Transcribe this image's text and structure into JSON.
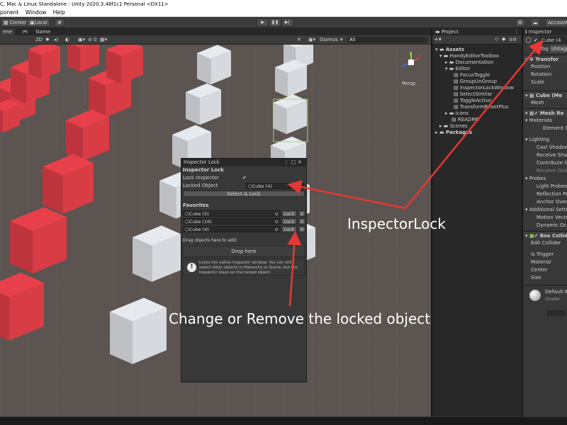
{
  "window": {
    "title": "C, Mac & Linux Standalone - Unity 2020.3.48f1c1 Personal <DX11>"
  },
  "menu": [
    "ponent",
    "Window",
    "Help"
  ],
  "toolbar": {
    "center": "Center",
    "local": "Local",
    "account": "Account"
  },
  "scene_tabs": {
    "scene": "ene",
    "game": "Game"
  },
  "scene_tools": {
    "mode": "2D",
    "gizmos": "Gizmos",
    "search_placeholder": "All",
    "zero": "0"
  },
  "gizmo_label": "Persp",
  "project": {
    "tab": "Project",
    "items": [
      "Assets",
      "HandyEditorToolbox",
      "Documentation",
      "Editor",
      "FocusToggle",
      "GroupUnGroup",
      "InspectorLockWindow",
      "SelectSimilar",
      "ToggleActive",
      "TransformResetPlus",
      "Icons",
      "README",
      "Scenes",
      "Packages"
    ],
    "badge": "9"
  },
  "inspector": {
    "tab": "Inspector",
    "object_name": "Cube (4",
    "tag_label": "Tag",
    "tag_value": "Untagg",
    "transform": "Transfor",
    "position": "Position",
    "rotation": "Rotation",
    "scale": "Scale",
    "mesh_filter": "Cube (Me",
    "mesh": "Mesh",
    "mesh_renderer": "Mesh Re",
    "materials": "Materials",
    "element0": "Element 0",
    "lighting": "Lighting",
    "cast_shadows": "Cast Shadow",
    "receive_shadows": "Receive Shad",
    "contribute_gi": "Contribute Glo",
    "receive_gi": "Receive Glob",
    "probes": "Probes",
    "light_probes": "Light Probes",
    "reflection_probes": "Reflection Pro",
    "anchor_override": "Anchor Overr",
    "additional": "Additional Setti",
    "motion_vectors": "Motion Vector",
    "dynamic_occlusion": "Dynamic Occl",
    "box_collider": "Box Collid",
    "edit_collider": "Edit Collider",
    "is_trigger": "Is Trigger",
    "material": "Material",
    "center": "Center",
    "size": "Size",
    "default_material": "Default-M",
    "shader": "Shader"
  },
  "lock_window": {
    "title": "Inspector Lock",
    "header": "Inspector Lock",
    "lock_inspector_label": "Lock Inspector",
    "locked_object_label": "Locked Object",
    "locked_object_value": "Cube (4)",
    "select_lock_button": "Select & Lock",
    "favorites_header": "Favorites",
    "favorites": [
      {
        "name": "Cube (5)",
        "lock": "Lock",
        "remove": "X"
      },
      {
        "name": "Cube (16)",
        "lock": "Lock",
        "remove": "X"
      },
      {
        "name": "Cube (4)",
        "lock": "Lock",
        "remove": "X"
      }
    ],
    "drag_hint": "Drag objects here to add:",
    "drop_here": "Drop here",
    "help_text": "Locks the native Inspector window. You can still select other objects in Hierarchy or Scene, but the Inspector stays on the locked object."
  },
  "annotations": {
    "inspector_lock": "InspectorLock",
    "change_remove": "Change or Remove the locked object"
  },
  "colors": {
    "red_cube": "#e8404a",
    "white_cube": "#e6e9ee",
    "annotation_arrow": "#e53935"
  }
}
